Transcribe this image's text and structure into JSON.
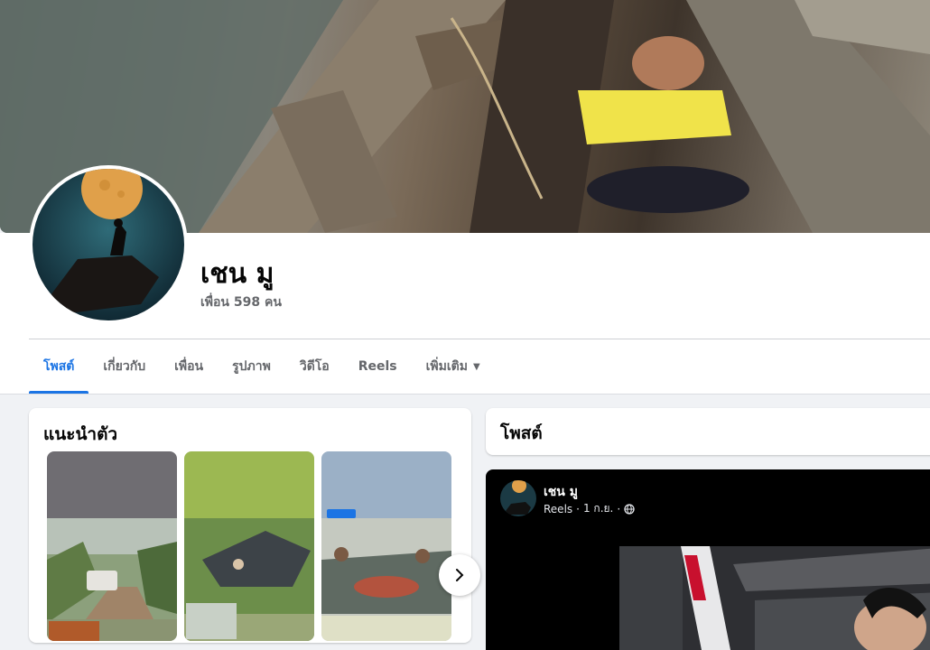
{
  "profile": {
    "name": "เชน มู",
    "friends": "เพื่อน 598 คน"
  },
  "tabs": [
    {
      "label": "โพสต์"
    },
    {
      "label": "เกี่ยวกับ"
    },
    {
      "label": "เพื่อน"
    },
    {
      "label": "รูปภาพ"
    },
    {
      "label": "วิดีโอ"
    },
    {
      "label": "Reels"
    },
    {
      "label": "เพิ่มเติม"
    }
  ],
  "intro": {
    "title": "แนะนำตัว"
  },
  "posts": {
    "title": "โพสต์",
    "first": {
      "author": "เชน มู",
      "source": "Reels",
      "time": "1 ก.ย.",
      "separator": "·"
    }
  },
  "colors": {
    "accent": "#1b74e4",
    "muted": "#65676b"
  },
  "icons": {
    "more_tab": "caret-down-icon",
    "carousel_next": "chevron-right-icon",
    "privacy": "globe-icon"
  }
}
